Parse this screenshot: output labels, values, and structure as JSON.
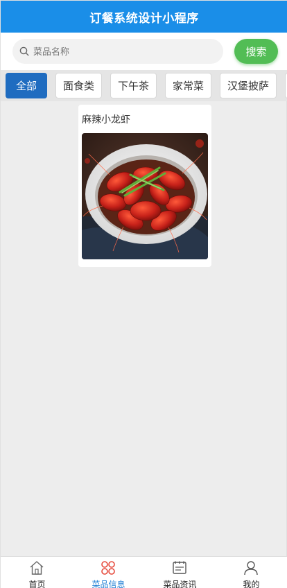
{
  "header": {
    "title": "订餐系统设计小程序"
  },
  "search": {
    "placeholder": "菜品名称",
    "button_label": "搜索"
  },
  "categories": [
    "全部",
    "面食类",
    "下午茶",
    "家常菜",
    "汉堡披萨"
  ],
  "active_category": "全部",
  "items": [
    {
      "name": "麻辣小龙虾",
      "image": "crayfish-dish-photo"
    }
  ],
  "tabbar": [
    {
      "label": "首页",
      "icon": "home-icon",
      "active": false
    },
    {
      "label": "菜品信息",
      "icon": "menu-grid-icon",
      "active": true
    },
    {
      "label": "菜品资讯",
      "icon": "news-icon",
      "active": false
    },
    {
      "label": "我的",
      "icon": "user-icon",
      "active": false
    }
  ],
  "colors": {
    "header": "#1a8ee8",
    "search_button": "#52bd55",
    "active_tab": "#1f6cc0",
    "active_nav": "#1f7fd4"
  }
}
